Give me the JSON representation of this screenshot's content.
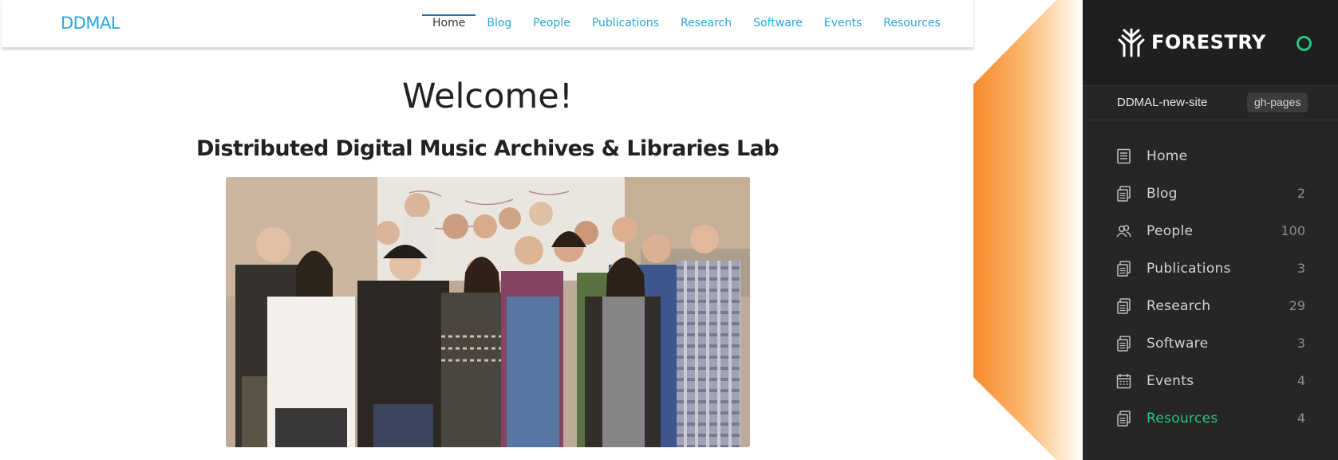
{
  "site": {
    "brand": "DDMAL",
    "nav": [
      {
        "label": "Home",
        "active": true
      },
      {
        "label": "Blog"
      },
      {
        "label": "People"
      },
      {
        "label": "Publications"
      },
      {
        "label": "Research"
      },
      {
        "label": "Software"
      },
      {
        "label": "Events"
      },
      {
        "label": "Resources"
      }
    ],
    "heading": "Welcome!",
    "subtitle": "Distributed Digital Music Archives & Libraries Lab"
  },
  "cms": {
    "logo_text": "FORESTRY",
    "site_name": "DDMAL-new-site",
    "branch": "gh-pages",
    "menu": [
      {
        "label": "Home",
        "count": "",
        "icon": "document-icon"
      },
      {
        "label": "Blog",
        "count": "2",
        "icon": "documents-icon"
      },
      {
        "label": "People",
        "count": "100",
        "icon": "people-icon"
      },
      {
        "label": "Publications",
        "count": "3",
        "icon": "documents-icon"
      },
      {
        "label": "Research",
        "count": "29",
        "icon": "documents-icon"
      },
      {
        "label": "Software",
        "count": "3",
        "icon": "documents-icon"
      },
      {
        "label": "Events",
        "count": "4",
        "icon": "calendar-icon"
      },
      {
        "label": "Resources",
        "count": "4",
        "icon": "documents-icon",
        "active": true
      }
    ]
  },
  "colors": {
    "link": "#2aa6e0",
    "accent_green": "#27c483",
    "orange": "#f7892a",
    "sidebar_bg": "#262626"
  }
}
